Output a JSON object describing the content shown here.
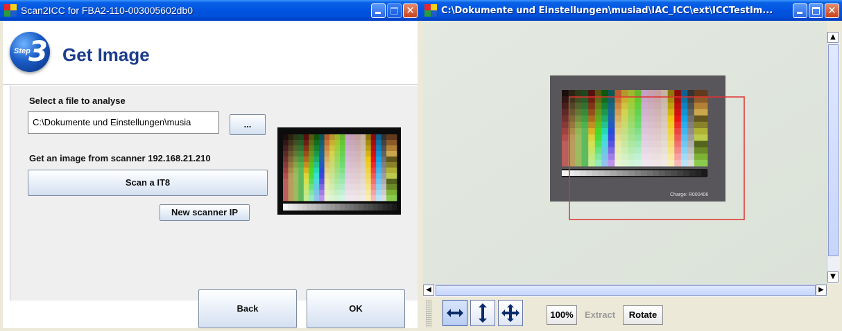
{
  "left_window": {
    "title": "Scan2ICC for FBA2-110-003005602db0",
    "step_word": "Step",
    "step_number": "3",
    "page_title": "Get Image",
    "file_section_label": "Select a file to analyse",
    "file_path_value": "C:\\Dokumente und Einstellungen\\musia",
    "browse_label": "...",
    "scanner_label": "Get an image from scanner 192.168.21.210",
    "scan_button": "Scan a IT8",
    "new_scanner_button": "New scanner IP",
    "back_button": "Back",
    "ok_button": "OK"
  },
  "right_window": {
    "title": "C:\\Dokumente und Einstellungen\\musiad\\IAC_ICC\\ext\\ICCTestIm...",
    "target_charge_text": "Charge: R000406",
    "toolbar": {
      "zoom_label": "100%",
      "extract_label": "Extract",
      "rotate_label": "Rotate"
    }
  },
  "colors": {
    "titlebar_blue": "#0053e1",
    "title_text_blue": "#1c3d8c",
    "selection_red": "#e03030"
  },
  "icons": {
    "fit_width": "double-arrow-horizontal-icon",
    "fit_height": "double-arrow-vertical-icon",
    "fit_all": "four-way-arrow-icon"
  }
}
